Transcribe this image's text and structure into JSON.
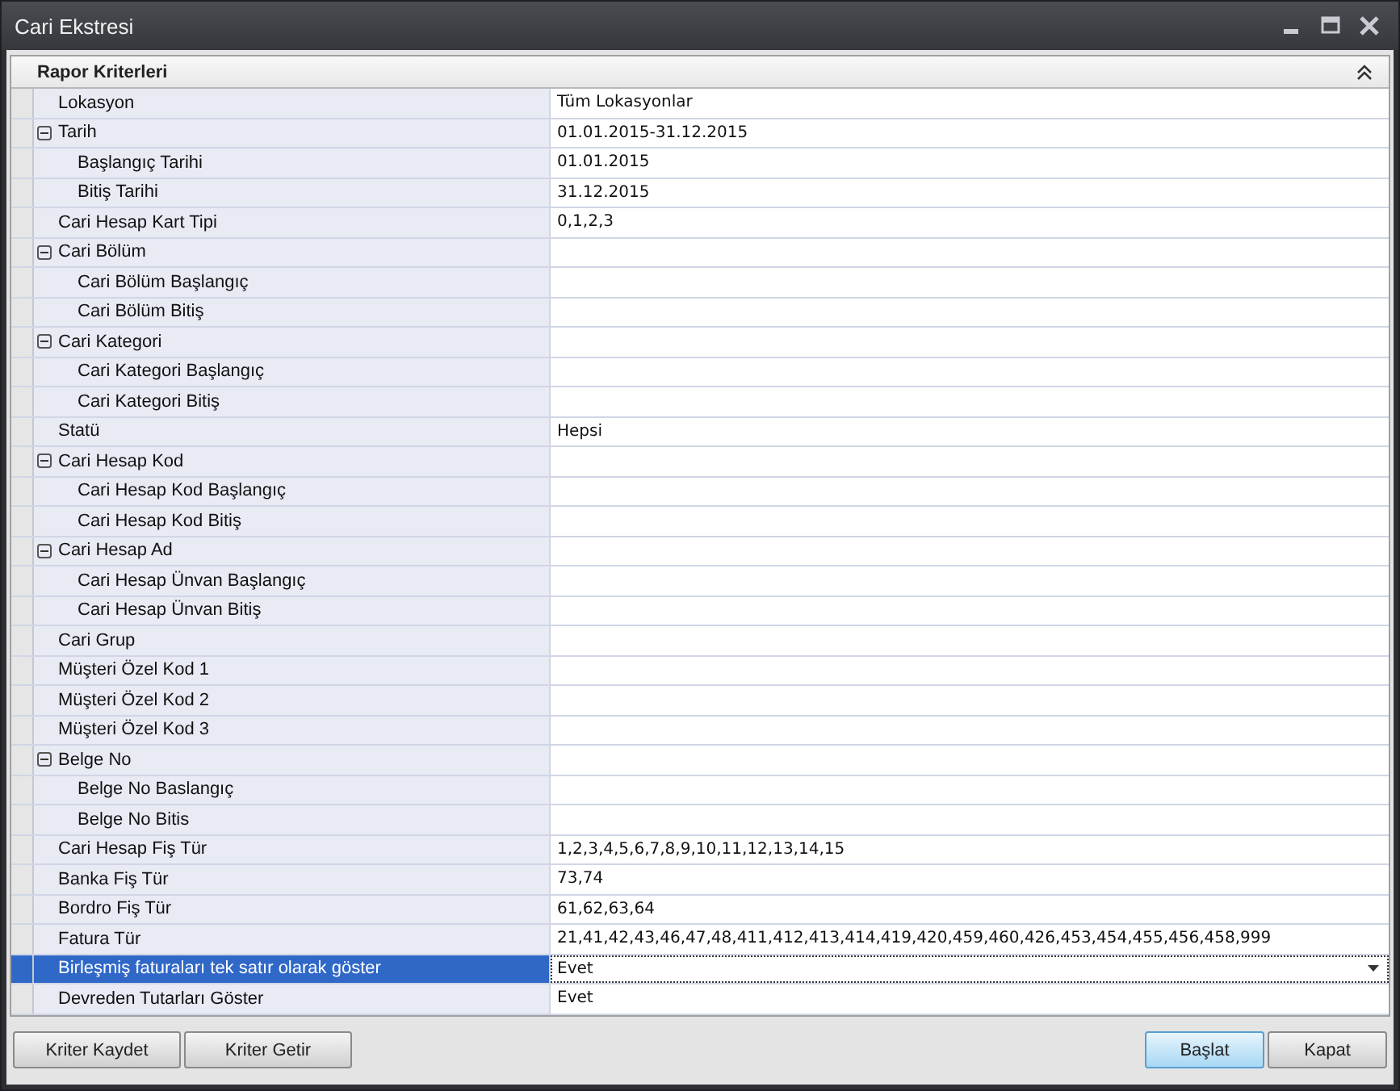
{
  "window": {
    "title": "Cari Ekstresi"
  },
  "panel": {
    "title": "Rapor Kriterleri"
  },
  "rows": [
    {
      "label": "Lokasyon",
      "value": "Tüm Lokasyonlar",
      "selected": false
    },
    {
      "label": "Tarih",
      "value": "01.01.2015-31.12.2015",
      "selected": false,
      "expanded": true,
      "children": [
        {
          "label": "Başlangıç Tarihi",
          "value": "01.01.2015",
          "selected": false
        },
        {
          "label": "Bitiş Tarihi",
          "value": "31.12.2015",
          "selected": false
        }
      ]
    },
    {
      "label": "Cari Hesap Kart Tipi",
      "value": "0,1,2,3",
      "selected": false
    },
    {
      "label": "Cari Bölüm",
      "selected": false,
      "expanded": true,
      "children": [
        {
          "label": "Cari Bölüm Başlangıç",
          "selected": false
        },
        {
          "label": "Cari Bölüm Bitiş",
          "selected": false
        }
      ]
    },
    {
      "label": "Cari Kategori",
      "selected": false,
      "expanded": true,
      "children": [
        {
          "label": "Cari Kategori Başlangıç",
          "selected": false
        },
        {
          "label": "Cari Kategori Bitiş",
          "selected": false
        }
      ]
    },
    {
      "label": "Statü",
      "value": "Hepsi",
      "selected": false
    },
    {
      "label": "Cari Hesap Kod",
      "selected": false,
      "expanded": true,
      "children": [
        {
          "label": "Cari Hesap Kod Başlangıç",
          "selected": false
        },
        {
          "label": "Cari Hesap Kod Bitiş",
          "selected": false
        }
      ]
    },
    {
      "label": "Cari Hesap Ad",
      "selected": false,
      "expanded": true,
      "children": [
        {
          "label": "Cari Hesap Ünvan Başlangıç",
          "selected": false
        },
        {
          "label": "Cari Hesap Ünvan Bitiş",
          "selected": false
        }
      ]
    },
    {
      "label": "Cari Grup",
      "selected": false
    },
    {
      "label": "Müşteri Özel Kod 1",
      "selected": false
    },
    {
      "label": "Müşteri Özel Kod 2",
      "selected": false
    },
    {
      "label": "Müşteri Özel Kod 3",
      "selected": false
    },
    {
      "label": "Belge No",
      "selected": false,
      "expanded": true,
      "children": [
        {
          "label": "Belge No Baslangıç",
          "selected": false
        },
        {
          "label": "Belge No Bitis",
          "selected": false
        }
      ]
    },
    {
      "label": "Cari Hesap Fiş Tür",
      "value": "1,2,3,4,5,6,7,8,9,10,11,12,13,14,15",
      "selected": false
    },
    {
      "label": "Banka Fiş Tür",
      "value": "73,74",
      "selected": false
    },
    {
      "label": "Bordro Fiş Tür",
      "value": "61,62,63,64",
      "selected": false
    },
    {
      "label": "Fatura Tür",
      "value": "21,41,42,43,46,47,48,411,412,413,414,419,420,459,460,426,453,454,455,456,458,999",
      "selected": false
    },
    {
      "label": "Birleşmiş faturaları tek satır olarak göster",
      "value": "Evet",
      "selected": true
    },
    {
      "label": "Devreden Tutarları Göster",
      "value": "Evet",
      "selected": false
    }
  ],
  "left_buttons": [
    "Kriter Kaydet",
    "Kriter Getir"
  ],
  "right_buttons": [
    {
      "label": "Başlat",
      "selected": true
    },
    {
      "label": "Kapat",
      "selected": false
    }
  ]
}
